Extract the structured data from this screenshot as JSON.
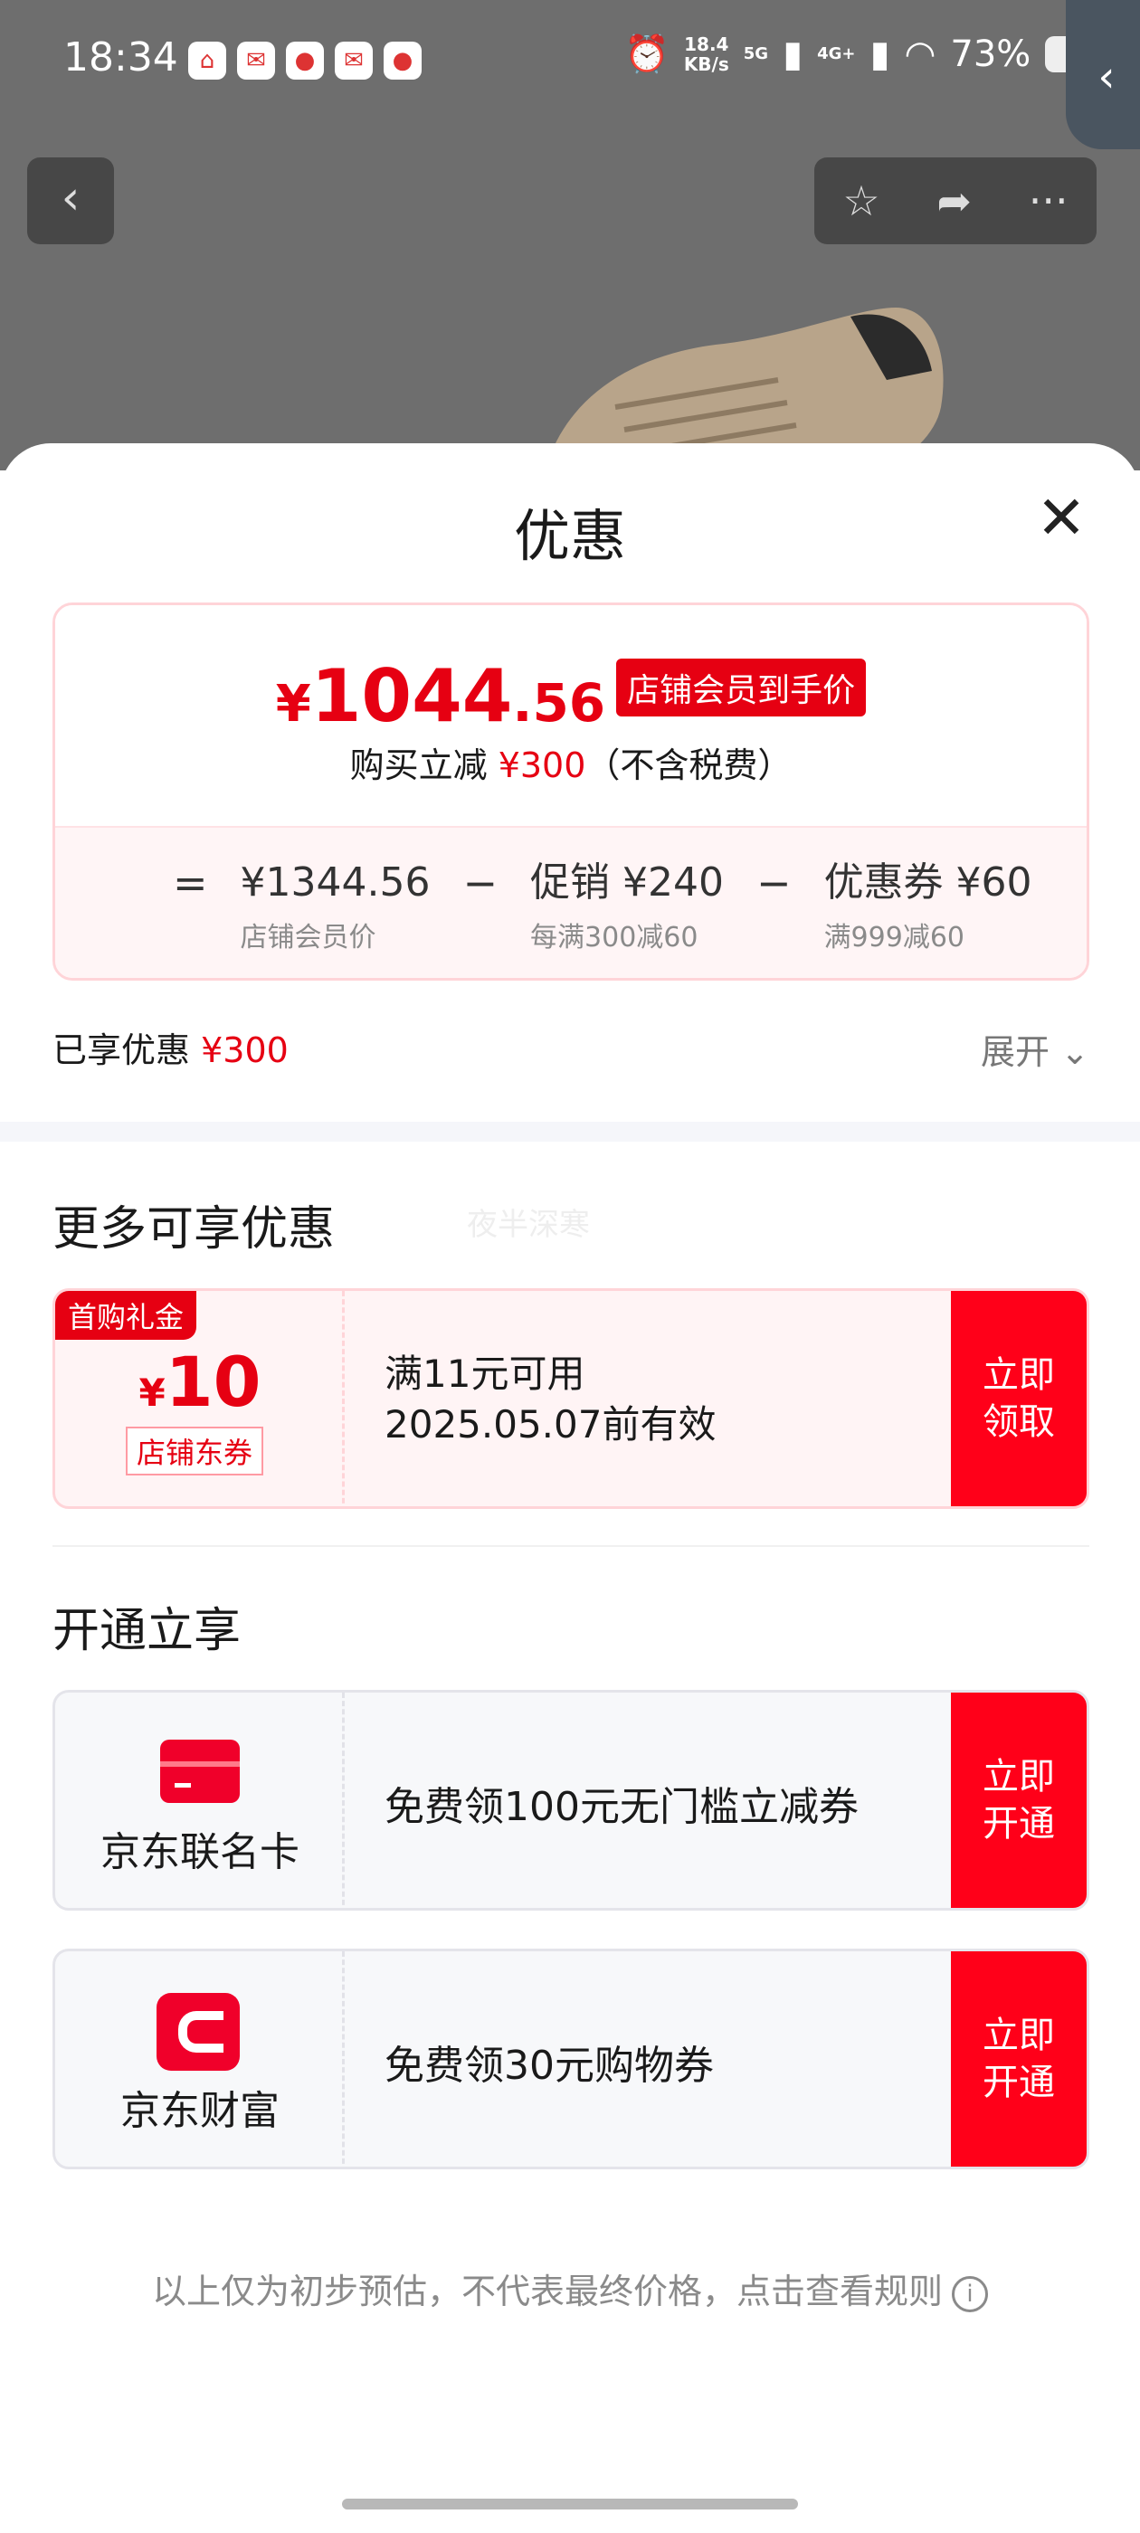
{
  "status_bar": {
    "time": "18:34",
    "speed": "18.4",
    "speed_unit": "KB/s",
    "net1": "5G",
    "net2": "4G+",
    "battery": "73%"
  },
  "sheet": {
    "title": "优惠",
    "final_price": {
      "currency": "¥",
      "integer": "1044",
      "decimal": ".56",
      "tag": "店铺会员到手价"
    },
    "saving": {
      "prefix": "购买立减",
      "amount": "¥300",
      "suffix": "（不含税费）"
    },
    "formula": {
      "eq": "=",
      "minus": "−",
      "member_price": {
        "value": "¥1344.56",
        "label": "店铺会员价"
      },
      "promotion": {
        "value": "促销 ¥240",
        "label": "每满300减60"
      },
      "coupon": {
        "value": "优惠券 ¥60",
        "label": "满999减60"
      }
    },
    "enjoyed": {
      "label": "已享优惠",
      "amount": "¥300"
    },
    "expand_label": "展开"
  },
  "more_offers": {
    "title": "更多可享优惠",
    "watermark": "夜半深寒",
    "coupon": {
      "badge": "首购礼金",
      "currency": "¥",
      "amount": "10",
      "type": "店铺东券",
      "condition": "满11元可用",
      "expiry": "2025.05.07前有效",
      "button": "立即领取"
    }
  },
  "activate": {
    "title": "开通立享",
    "cards": [
      {
        "name": "京东联名卡",
        "desc": "免费领100元无门槛立减券",
        "button": "立即开通",
        "icon": "credit-card-icon"
      },
      {
        "name": "京东财富",
        "desc": "免费领30元购物券",
        "button": "立即开通",
        "icon": "jd-wealth-icon"
      }
    ]
  },
  "footer_note": "以上仅为初步预估，不代表最终价格，点击查看规则",
  "colors": {
    "accent": "#e60012",
    "button_red": "#ff0019",
    "border_pink": "#ffd4d8"
  }
}
